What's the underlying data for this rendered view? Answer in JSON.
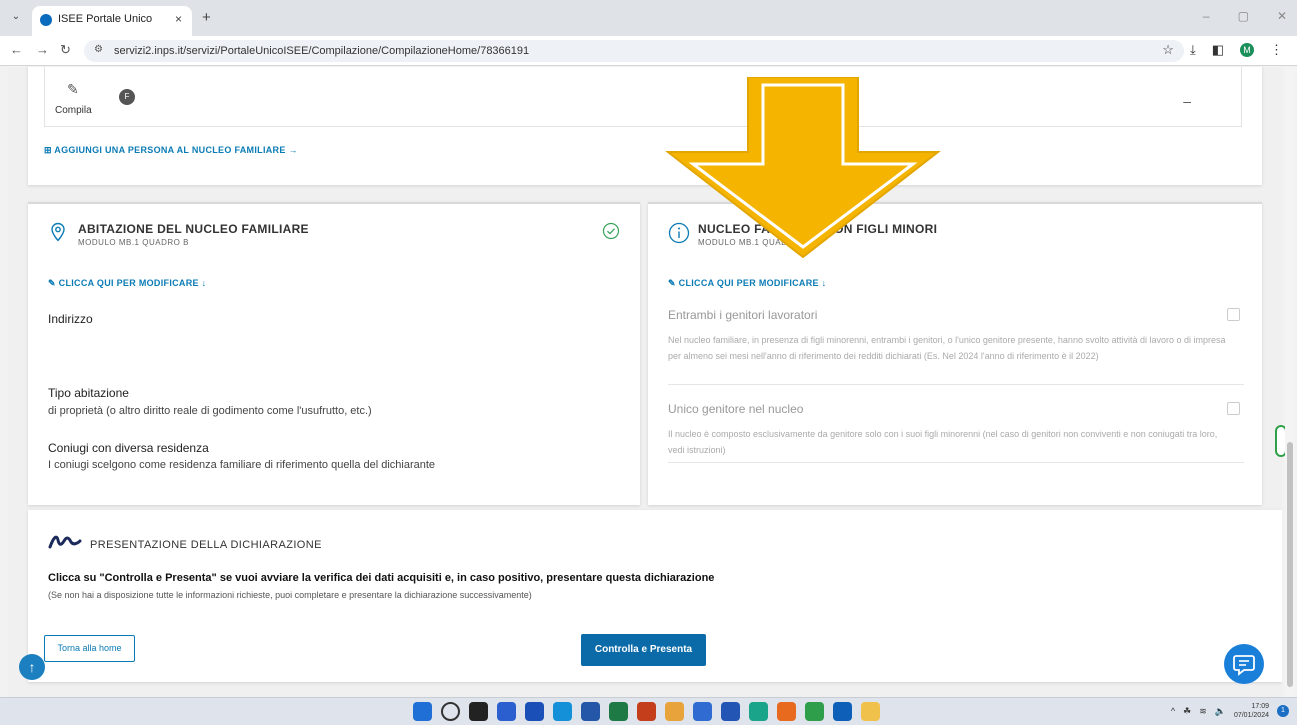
{
  "browser": {
    "tab_title": "ISEE Portale Unico",
    "new_tab_symbol": "+",
    "close_symbol": "×",
    "url": "servizi2.inps.it/servizi/PortaleUnicoISEE/Compilazione/CompilazioneHome/78366191",
    "profile_initial": "M"
  },
  "member_card": {
    "compila_label": "Compila",
    "avatar_initial": "F",
    "dash": "–",
    "add_person_link": "⊞ AGGIUNGI UNA PERSONA AL NUCLEO FAMILIARE →"
  },
  "abitazione": {
    "title": "ABITAZIONE DEL NUCLEO FAMILIARE",
    "subtitle": "MODULO MB.1 QUADRO B",
    "edit_link": "CLICCA QUI PER MODIFICARE ↓",
    "indirizzo_label": "Indirizzo",
    "tipo_label": "Tipo abitazione",
    "tipo_value": "di proprietà (o altro diritto reale di godimento come l'usufrutto, etc.)",
    "coniugi_label": "Coniugi con diversa residenza",
    "coniugi_value": "I coniugi scelgono come residenza familiare di riferimento quella del dichiarante"
  },
  "nucleo_minori": {
    "title": "NUCLEO FAMILIARE CON FIGLI MINORI",
    "subtitle": "MODULO MB.1 QUADRO A",
    "edit_link": "CLICCA QUI PER MODIFICARE ↓",
    "options": [
      {
        "title": "Entrambi i genitori lavoratori",
        "desc": "Nel nucleo familiare, in presenza di figli minorenni, entrambi i genitori, o l'unico genitore presente, hanno svolto attività di lavoro o di impresa per almeno sei mesi nell'anno di riferimento dei redditi dichiarati (Es. Nel 2024 l'anno di riferimento è il 2022)",
        "checked": false
      },
      {
        "title": "Unico genitore nel nucleo",
        "desc": "Il nucleo è composto esclusivamente da genitore solo con i suoi figli minorenni (nel caso di genitori non conviventi e non coniugati tra loro, vedi istruzioni)",
        "checked": false
      }
    ]
  },
  "presentazione": {
    "title": "PRESENTAZIONE DELLA DICHIARAZIONE",
    "main_text": "Clicca su \"Controlla e Presenta\" se vuoi avviare la verifica dei dati acquisiti e, in caso positivo, presentare questa dichiarazione",
    "sub_text": "(Se non hai a disposizione tutte le informazioni richieste, puoi completare e presentare la dichiarazione successivamente)",
    "home_button": "Torna alla home",
    "submit_button": "Controlla e Presenta"
  },
  "taskbar": {
    "time": "17:09",
    "date": "07/01/2024",
    "notifications": "1"
  },
  "colors": {
    "accent": "#0b7bb5",
    "button_primary": "#0b6ba8",
    "arrow": "#f5b400"
  }
}
